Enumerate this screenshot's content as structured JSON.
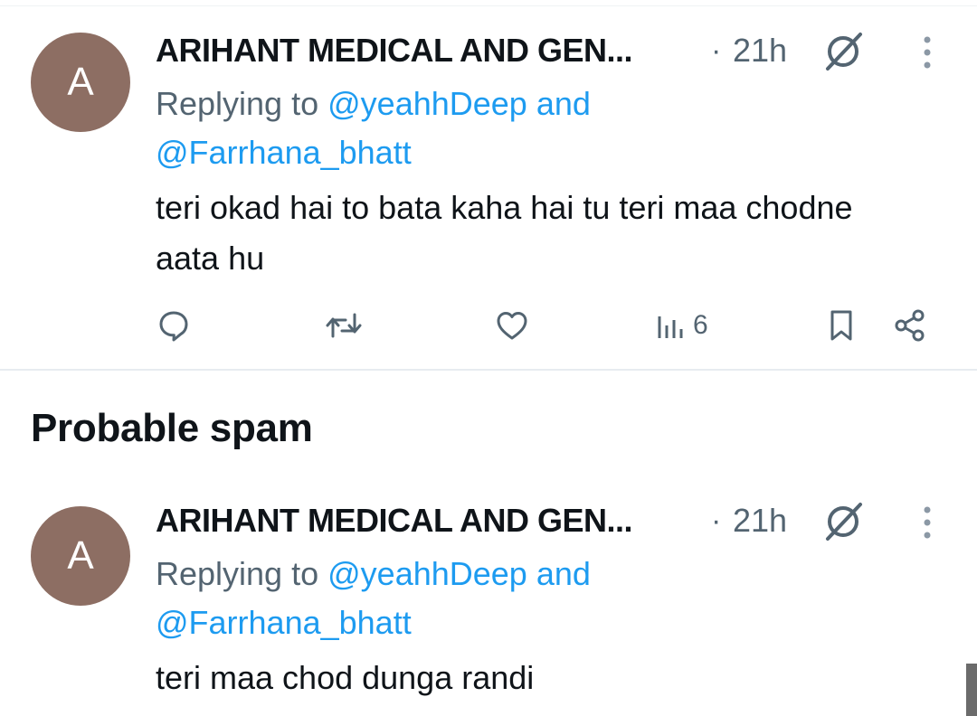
{
  "tweets": [
    {
      "avatar_letter": "A",
      "author": "ARIHANT MEDICAL AND GEN...",
      "separator": "·",
      "time": "21h",
      "replying_prefix": "Replying to",
      "reply_handle_1": "@yeahhDeep",
      "reply_and": "and",
      "reply_handle_2": "@Farrhana_bhatt",
      "text": "teri okad hai to bata kaha hai tu teri maa chodne aata hu",
      "views": "6"
    },
    {
      "avatar_letter": "A",
      "author": "ARIHANT MEDICAL AND GEN...",
      "separator": "·",
      "time": "21h",
      "replying_prefix": "Replying to",
      "reply_handle_1": "@yeahhDeep",
      "reply_and": "and",
      "reply_handle_2": "@Farrhana_bhatt",
      "text": "teri maa chod dunga randi"
    }
  ],
  "section": {
    "heading": "Probable spam"
  },
  "icons": {
    "reply": "speech-bubble-icon",
    "repost": "repost-arrows-icon",
    "like": "heart-icon",
    "views": "bar-chart-icon",
    "bookmark": "bookmark-icon",
    "share": "share-nodes-icon",
    "grok": "grok-slash-circle-icon",
    "more": "vertical-ellipsis-icon"
  },
  "colors": {
    "accent": "#1d9bf0",
    "muted": "#536471",
    "avatar": "#8d6e63",
    "text": "#0f1419"
  }
}
